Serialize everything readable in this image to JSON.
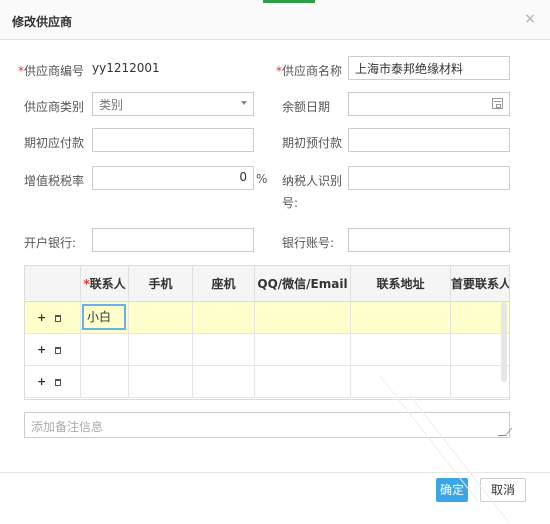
{
  "dialog": {
    "title": "修改供应商",
    "close_icon": "×"
  },
  "form": {
    "supplier_code": {
      "label": "供应商编号",
      "value": "yy1212001",
      "required": true
    },
    "supplier_name": {
      "label": "供应商名称",
      "value": "上海市泰邦绝缘材料",
      "required": true
    },
    "supplier_type": {
      "label": "供应商类别",
      "value": "类别"
    },
    "balance_date": {
      "label": "余额日期",
      "value": ""
    },
    "opening_payable": {
      "label": "期初应付款",
      "value": ""
    },
    "opening_prepaid": {
      "label": "期初预付款",
      "value": ""
    },
    "vat_rate": {
      "label": "增值税税率",
      "value": "0",
      "unit": "%"
    },
    "taxpayer_id": {
      "label_line1": "纳税人识别",
      "label_line2": "号:",
      "value": ""
    },
    "bank": {
      "label": "开户银行:",
      "value": ""
    },
    "bank_account": {
      "label": "银行账号:",
      "value": ""
    }
  },
  "contacts_table": {
    "columns": [
      "联系人",
      "手机",
      "座机",
      "QQ/微信/Email",
      "联系地址",
      "首要联系人"
    ],
    "required_marker": "*",
    "rows": [
      {
        "ops_add": "+",
        "contact": "小白",
        "mobile": "",
        "phone": "",
        "im": "",
        "address": "",
        "primary": ""
      },
      {
        "ops_add": "+",
        "contact": "",
        "mobile": "",
        "phone": "",
        "im": "",
        "address": "",
        "primary": ""
      },
      {
        "ops_add": "+",
        "contact": "",
        "mobile": "",
        "phone": "",
        "im": "",
        "address": "",
        "primary": ""
      }
    ]
  },
  "remark": {
    "placeholder": "添加备注信息"
  },
  "buttons": {
    "confirm": "确定",
    "cancel": "取消"
  },
  "colors": {
    "primary_button": "#3aa6e8",
    "selected_row": "#ffffcc",
    "required": "#e33"
  }
}
